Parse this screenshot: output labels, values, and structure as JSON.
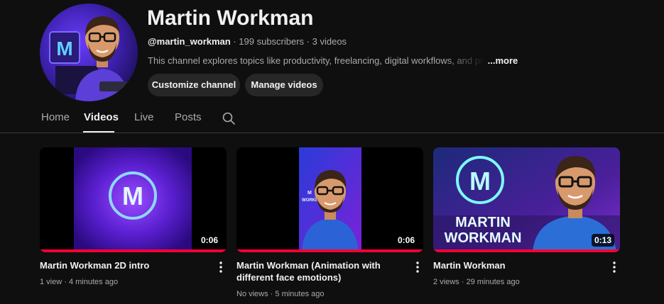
{
  "channel": {
    "name": "Martin Workman",
    "handle": "@martin_workman",
    "separator": " · ",
    "subscribers": "199 subscribers",
    "videos_count": "3 videos",
    "description": "This channel explores topics like productivity, freelancing, digital workflows, and practical",
    "more_label": "...more",
    "avatar_letter": "M"
  },
  "buttons": {
    "customize": "Customize channel",
    "manage": "Manage videos"
  },
  "tabs": [
    {
      "label": "Home",
      "active": false
    },
    {
      "label": "Videos",
      "active": true
    },
    {
      "label": "Live",
      "active": false
    },
    {
      "label": "Posts",
      "active": false
    }
  ],
  "icons": {
    "search": "search-icon",
    "more_actions": "more-vert-icon"
  },
  "videos": [
    {
      "title": "Martin Workman 2D intro",
      "views": "1 view",
      "age": "4 minutes ago",
      "duration": "0:06",
      "thumb_letter": "M"
    },
    {
      "title": "Martin Workman (Animation with different face emotions)",
      "views": "No views",
      "age": "5 minutes ago",
      "duration": "0:06",
      "thumb_letter": "M",
      "thumb_text": "WORKMAN"
    },
    {
      "title": "Martin Workman",
      "views": "2 views",
      "age": "29 minutes ago",
      "duration": "0:13",
      "thumb_letter": "M",
      "thumb_text_line1": "MARTIN",
      "thumb_text_line2": "WORKMAN"
    }
  ],
  "colors": {
    "background": "#0f0f0f",
    "button_bg": "#272727",
    "progress": "#ff0033",
    "accent_purple": "#7b2cff",
    "accent_cyan": "#7ef9ff"
  }
}
